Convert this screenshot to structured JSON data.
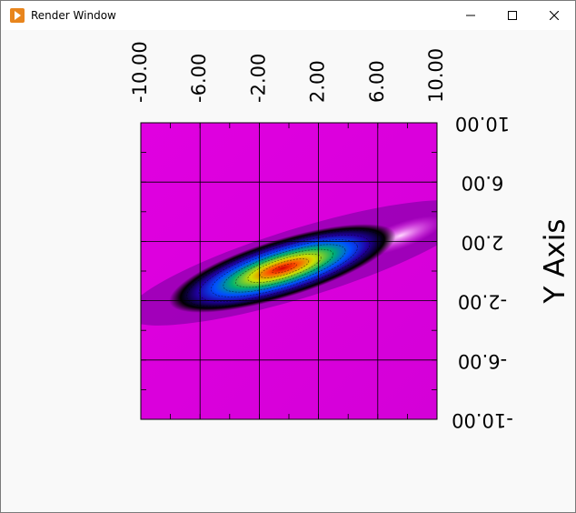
{
  "window": {
    "title": "Render Window",
    "icon": "render-window-app-icon",
    "controls": [
      "minimize-icon",
      "maximize-icon",
      "close-icon"
    ]
  },
  "chart_data": {
    "type": "heatmap",
    "description_note": "",
    "x_axis": {
      "label": "",
      "range": [
        -10,
        10
      ],
      "ticks": [
        "-10.00",
        "-6.00",
        "-2.00",
        "2.00",
        "6.00",
        "10.00"
      ],
      "orientation": "top, labels rotated"
    },
    "y_axis": {
      "label": "Y Axis",
      "range": [
        -10,
        10
      ],
      "ticks": [
        "10.00",
        "6.00",
        "2.00",
        "-2.00",
        "-6.00",
        "-10.00"
      ],
      "orientation": "right, labels upside-down"
    },
    "grid": true,
    "background_color": "#e000e0",
    "colormap": [
      "#000000",
      "#2000c0",
      "#0060ff",
      "#00c060",
      "#c0e000",
      "#ff6000",
      "#d00000"
    ],
    "contours": true
  }
}
